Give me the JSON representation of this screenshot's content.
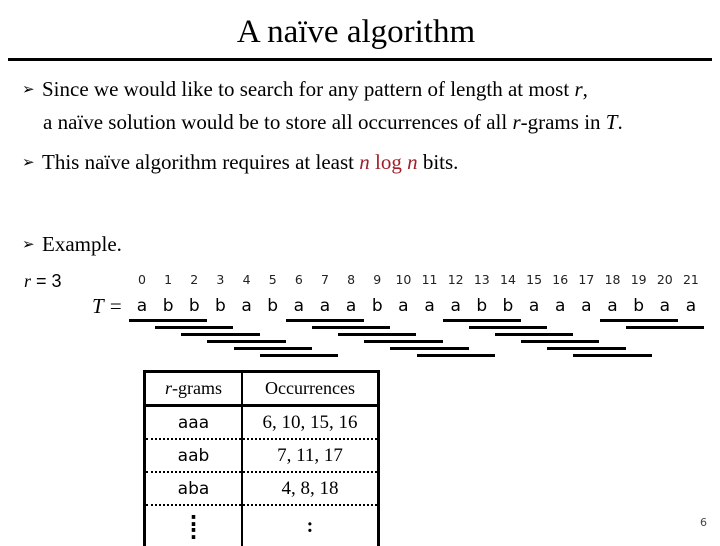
{
  "title": "A naïve algorithm",
  "bullets": [
    {
      "line1_pre": "Since we would like to search for any pattern of length at most ",
      "line1_var": "r",
      "line1_post": ",",
      "line2_pre": "a naïve solution would be to store all occurrences of all ",
      "line2_var": "r",
      "line2_mid": "-grams in ",
      "line2_var2": "T",
      "line2_post": "."
    },
    {
      "pre": "This naïve algorithm requires at least ",
      "formula_n1": "n",
      "formula_log": " log ",
      "formula_n2": "n",
      "post": " bits."
    },
    {
      "text": "Example."
    }
  ],
  "bullet_glyph": "➢",
  "example": {
    "r_var": "r",
    "r_eq": " = ",
    "r_value": "3",
    "t_label": "T =",
    "indices": [
      "0",
      "1",
      "2",
      "3",
      "4",
      "5",
      "6",
      "7",
      "8",
      "9",
      "10",
      "11",
      "12",
      "13",
      "14",
      "15",
      "16",
      "17",
      "18",
      "19",
      "20",
      "21"
    ],
    "text": [
      "a",
      "b",
      "b",
      "b",
      "a",
      "b",
      "a",
      "a",
      "a",
      "b",
      "a",
      "a",
      "a",
      "b",
      "b",
      "a",
      "a",
      "a",
      "a",
      "b",
      "a",
      "a"
    ],
    "gram_length": 3,
    "num_grams": 20
  },
  "table": {
    "header_var": "r",
    "header_col1": "-grams",
    "header_col2": "Occurrences",
    "rows": [
      {
        "gram": "aaa",
        "occ": "6, 10, 15, 16"
      },
      {
        "gram": "aab",
        "occ": "7, 11, 17"
      },
      {
        "gram": "aba",
        "occ": "4, 8, 18"
      }
    ],
    "ellipsis_col1": ":",
    "ellipsis_col2": ":"
  },
  "colors": {
    "accent_red": "#a0202a"
  },
  "page_number": "6"
}
